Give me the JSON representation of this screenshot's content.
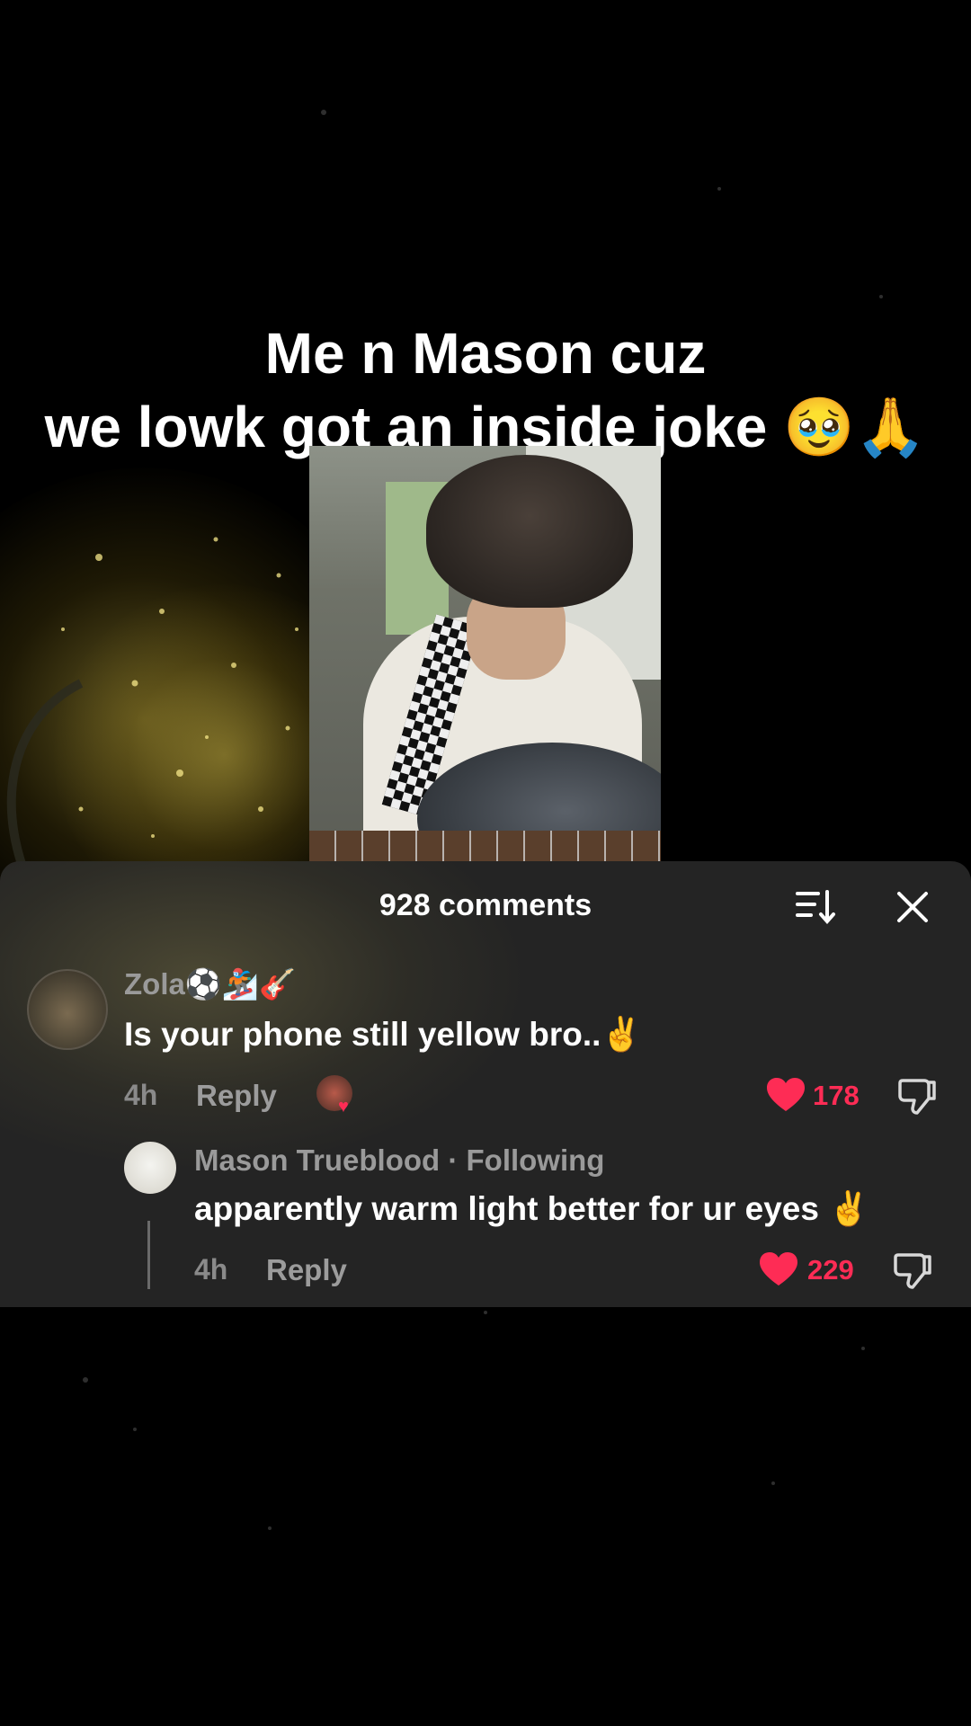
{
  "video": {
    "caption_line1": "Me n Mason cuz",
    "caption_line2": "we lowk got an inside joke 🥹🙏"
  },
  "comments_panel": {
    "title": "928 comments",
    "sort_icon": "sort-icon",
    "close_icon": "close-icon"
  },
  "comments": [
    {
      "author": "Zola⚽️🏂🎸",
      "text": "Is your phone still yellow bro..✌️",
      "time": "4h",
      "reply_label": "Reply",
      "likes": "178",
      "liked": true
    }
  ],
  "replies": [
    {
      "author": "Mason Trueblood",
      "author_badge": "· Following",
      "text": "apparently warm light better for ur eyes ✌️",
      "time": "4h",
      "reply_label": "Reply",
      "likes": "229",
      "liked": true
    }
  ],
  "colors": {
    "like": "#fe2c55",
    "panel_bg": "#242424",
    "background": "#000000"
  }
}
